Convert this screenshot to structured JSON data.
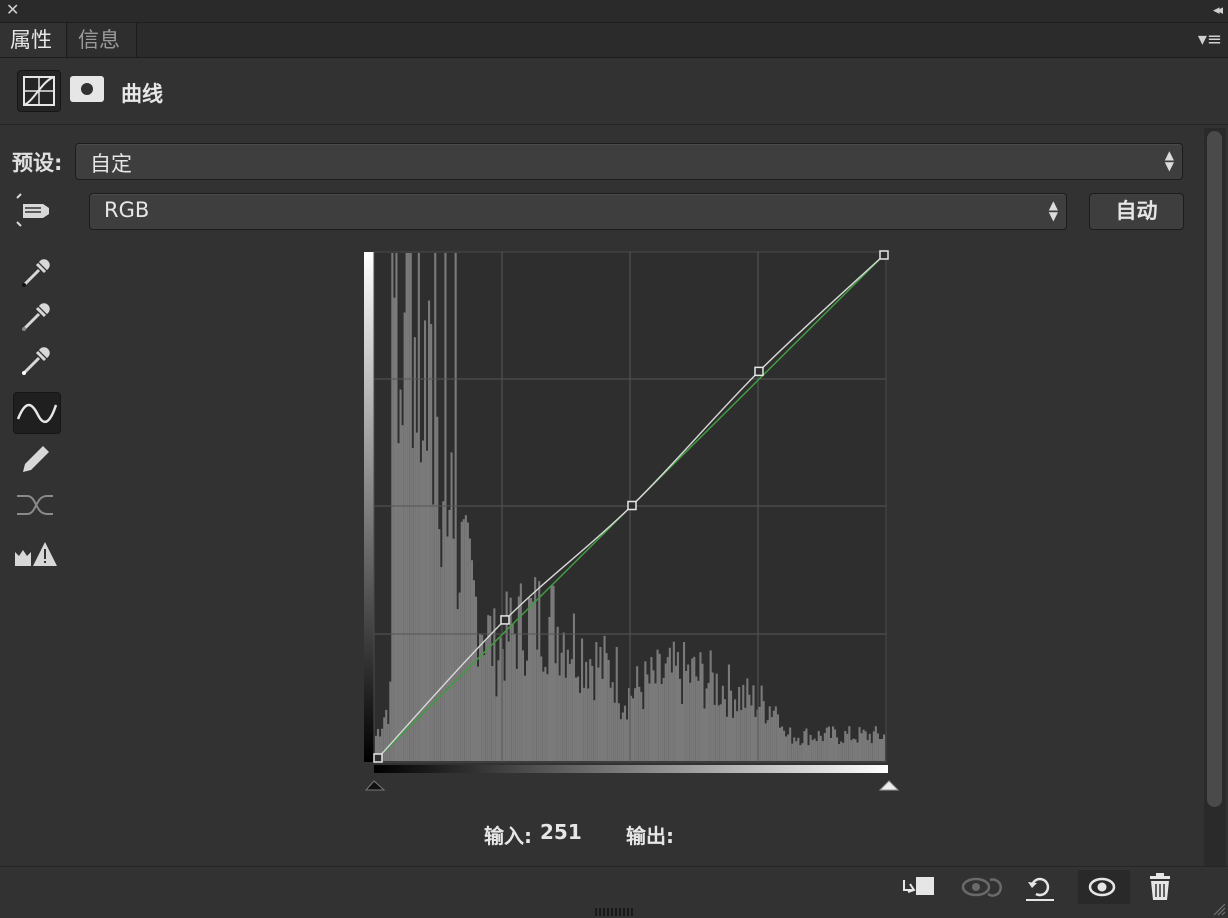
{
  "window": {
    "close_glyph": "✕",
    "collapse_glyph": "◂◂"
  },
  "tabs": [
    {
      "label": "属性"
    },
    {
      "label": "信息"
    }
  ],
  "panel_menu_glyph": "▾≡",
  "adjustment": {
    "title": "曲线"
  },
  "preset": {
    "label": "预设:",
    "value": "自定"
  },
  "channel": {
    "value": "RGB"
  },
  "auto_button": {
    "label": "自动"
  },
  "tools": [
    {
      "icon": "hand-target-icon"
    },
    {
      "icon": "black-eyedropper-icon"
    },
    {
      "icon": "gray-eyedropper-icon"
    },
    {
      "icon": "white-eyedropper-icon"
    },
    {
      "icon": "curve-points-icon",
      "active": true
    },
    {
      "icon": "pencil-icon"
    },
    {
      "icon": "smooth-curve-icon"
    },
    {
      "icon": "clipping-warning-icon"
    }
  ],
  "io": {
    "input_label": "输入:",
    "input_value": "251",
    "output_label": "输出:",
    "output_value": ""
  },
  "curve": {
    "rgb_points": [
      [
        0,
        0
      ],
      [
        64,
        70
      ],
      [
        128,
        128
      ],
      [
        192,
        196
      ],
      [
        255,
        255
      ]
    ],
    "green_points": [
      [
        0,
        0
      ],
      [
        255,
        255
      ]
    ]
  },
  "bottom_icons": [
    "clip-to-layer-icon",
    "view-previous-state-icon",
    "reset-icon",
    "visibility-eye-icon",
    "trash-icon"
  ],
  "colors": {
    "panel_bg": "#323232",
    "histogram": "#7a7a7a",
    "curve": "#d8d8d8",
    "green_curve": "#3f9f3f",
    "graph_bg": "#2e2e2e"
  }
}
